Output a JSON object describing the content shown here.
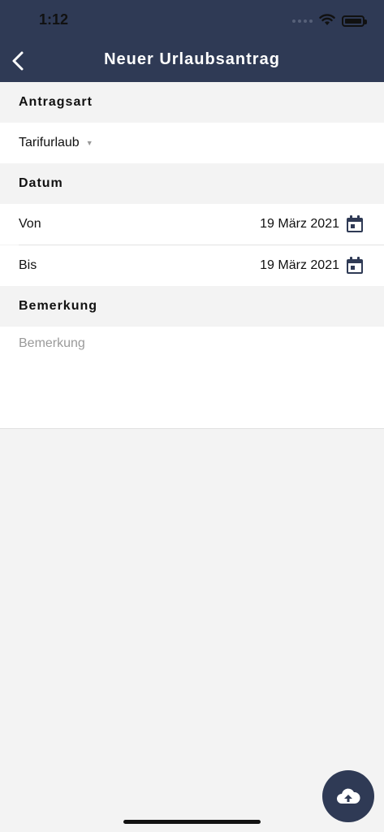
{
  "status_bar": {
    "time": "1:12"
  },
  "header": {
    "title": "Neuer Urlaubsantrag",
    "back_icon": "chevron-left-icon"
  },
  "sections": {
    "type": {
      "label": "Antragsart",
      "selected": "Tarifurlaub"
    },
    "date": {
      "label": "Datum",
      "from_label": "Von",
      "from_value": "19 März 2021",
      "to_label": "Bis",
      "to_value": "19 März 2021"
    },
    "remark": {
      "label": "Bemerkung",
      "placeholder": "Bemerkung",
      "value": ""
    }
  },
  "fab": {
    "icon": "cloud-upload-icon"
  },
  "colors": {
    "primary": "#2f3a55",
    "background": "#f3f3f3"
  }
}
